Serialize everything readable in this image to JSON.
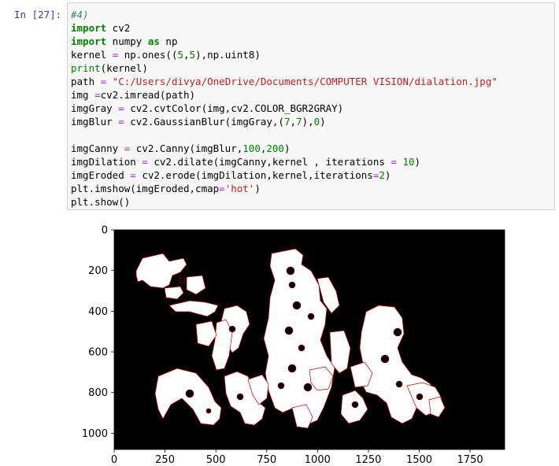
{
  "cell": {
    "prompt": "In [27]:",
    "code_lines": [
      [
        {
          "t": "cm",
          "s": "#4)"
        }
      ],
      [
        {
          "t": "kw",
          "s": "import"
        },
        {
          "t": "tx",
          "s": " cv2"
        }
      ],
      [
        {
          "t": "kw",
          "s": "import"
        },
        {
          "t": "tx",
          "s": " numpy "
        },
        {
          "t": "kw",
          "s": "as"
        },
        {
          "t": "tx",
          "s": " np"
        }
      ],
      [
        {
          "t": "tx",
          "s": "kernel "
        },
        {
          "t": "eq",
          "s": "="
        },
        {
          "t": "tx",
          "s": " np.ones(("
        },
        {
          "t": "num",
          "s": "5"
        },
        {
          "t": "tx",
          "s": ","
        },
        {
          "t": "num",
          "s": "5"
        },
        {
          "t": "tx",
          "s": "),np.uint8)"
        }
      ],
      [
        {
          "t": "bi",
          "s": "print"
        },
        {
          "t": "tx",
          "s": "(kernel)"
        }
      ],
      [
        {
          "t": "tx",
          "s": "path "
        },
        {
          "t": "eq",
          "s": "="
        },
        {
          "t": "tx",
          "s": " "
        },
        {
          "t": "str",
          "s": "\"C:/Users/divya/OneDrive/Documents/COMPUTER VISION/dialation.jpg\""
        }
      ],
      [
        {
          "t": "tx",
          "s": "img "
        },
        {
          "t": "eq",
          "s": "="
        },
        {
          "t": "tx",
          "s": "cv2.imread(path)"
        }
      ],
      [
        {
          "t": "tx",
          "s": "imgGray "
        },
        {
          "t": "eq",
          "s": "="
        },
        {
          "t": "tx",
          "s": " cv2.cvtColor(img,cv2.COLOR_BGR2GRAY)"
        }
      ],
      [
        {
          "t": "tx",
          "s": "imgBlur "
        },
        {
          "t": "eq",
          "s": "="
        },
        {
          "t": "tx",
          "s": " cv2.GaussianBlur(imgGray,("
        },
        {
          "t": "num",
          "s": "7"
        },
        {
          "t": "tx",
          "s": ","
        },
        {
          "t": "num",
          "s": "7"
        },
        {
          "t": "tx",
          "s": "),"
        },
        {
          "t": "num",
          "s": "0"
        },
        {
          "t": "tx",
          "s": ")"
        }
      ],
      [],
      [
        {
          "t": "tx",
          "s": "imgCanny "
        },
        {
          "t": "eq",
          "s": "="
        },
        {
          "t": "tx",
          "s": " cv2.Canny(imgBlur,"
        },
        {
          "t": "num",
          "s": "100"
        },
        {
          "t": "tx",
          "s": ","
        },
        {
          "t": "num",
          "s": "200"
        },
        {
          "t": "tx",
          "s": ")"
        }
      ],
      [
        {
          "t": "tx",
          "s": "imgDilation "
        },
        {
          "t": "eq",
          "s": "="
        },
        {
          "t": "tx",
          "s": " cv2.dilate(imgCanny,kernel , iterations "
        },
        {
          "t": "eq",
          "s": "="
        },
        {
          "t": "tx",
          "s": " "
        },
        {
          "t": "num",
          "s": "10"
        },
        {
          "t": "tx",
          "s": ")"
        }
      ],
      [
        {
          "t": "tx",
          "s": "imgEroded "
        },
        {
          "t": "eq",
          "s": "="
        },
        {
          "t": "tx",
          "s": " cv2.erode(imgDilation,kernel,iterations"
        },
        {
          "t": "eq",
          "s": "="
        },
        {
          "t": "num",
          "s": "2"
        },
        {
          "t": "tx",
          "s": ")"
        }
      ],
      [
        {
          "t": "tx",
          "s": "plt.imshow(imgEroded,cmap"
        },
        {
          "t": "eq",
          "s": "="
        },
        {
          "t": "str",
          "s": "'hot'"
        },
        {
          "t": "tx",
          "s": ")"
        }
      ],
      [
        {
          "t": "tx",
          "s": "plt.show()"
        }
      ]
    ]
  },
  "chart_data": {
    "type": "heatmap",
    "colormap": "hot",
    "image_background": "#000000",
    "foreground_color": "#ffffff",
    "edge_color": "#b40000",
    "xlim": [
      0,
      1920
    ],
    "ylim": [
      1080,
      0
    ],
    "x_ticks": [
      0,
      250,
      500,
      750,
      1000,
      1250,
      1500,
      1750
    ],
    "x_tick_labels": [
      "0",
      "250",
      "500",
      "750",
      "1000",
      "1250",
      "1500",
      "1750"
    ],
    "y_ticks": [
      0,
      200,
      400,
      600,
      800,
      1000
    ],
    "y_tick_labels": [
      "0",
      "200",
      "400",
      "600",
      "800",
      "1000"
    ]
  }
}
